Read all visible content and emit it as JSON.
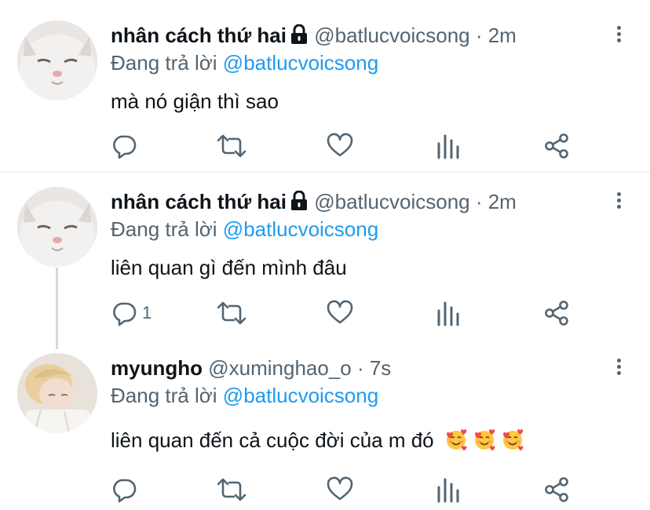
{
  "tweets": [
    {
      "name": "nhân cách thứ hai",
      "handle": "@batlucvoicsong · 2m",
      "reply_prefix": "Đang trả lời",
      "reply_to": "@batlucvoicsong",
      "text": "mà nó giận thì sao",
      "reply_count": ""
    },
    {
      "name": "nhân cách thứ hai",
      "handle": "@batlucvoicsong · 2m",
      "reply_prefix": "Đang trả lời",
      "reply_to": "@batlucvoicsong",
      "text": "liên quan gì đến mình đâu",
      "reply_count": "1"
    },
    {
      "name": "myungho",
      "handle": "@xuminghao_o · 7s",
      "reply_prefix": "Đang trả lời",
      "reply_to": "@batlucvoicsong",
      "text": "liên quan đến cả cuộc đời của m đó",
      "reply_count": ""
    }
  ],
  "icons": {
    "reply": "reply-icon",
    "retweet": "retweet-icon",
    "like": "heart-icon",
    "analytics": "analytics-icon",
    "share": "share-icon",
    "more": "more-icon",
    "lock": "lock-icon",
    "emoji": "smiling-face-with-hearts-emoji"
  },
  "colors": {
    "text": "#0f1419",
    "secondary": "#536471",
    "link": "#1d9bf0",
    "divider": "#e6e9eb",
    "thread_line": "#cfd9de"
  }
}
